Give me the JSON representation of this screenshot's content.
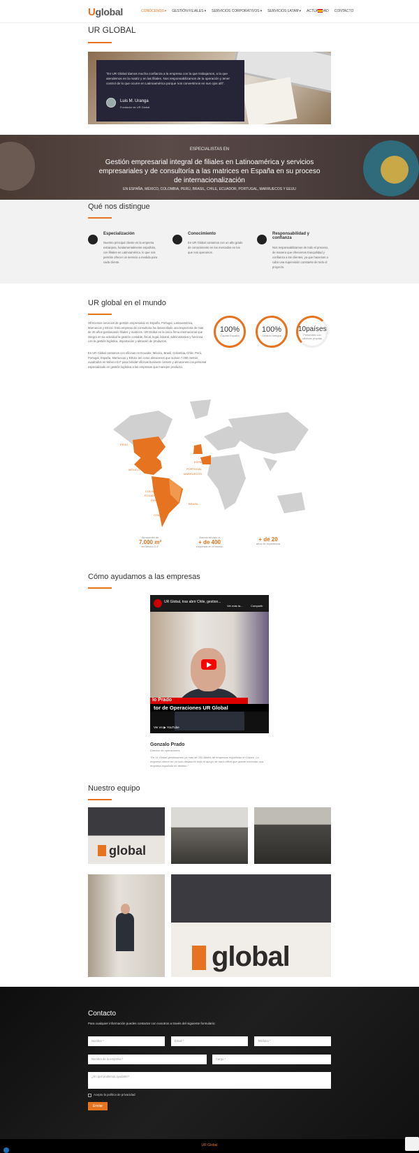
{
  "header": {
    "logo_u": "U",
    "logo_text": "global",
    "nav": [
      "CONÓCENOS",
      "GESTIÓN FILIALES",
      "SERVICIOS CORPORATIVOS",
      "SERVICIOS LATAM",
      "ACTUALIDAD",
      "CONTACTO"
    ]
  },
  "title": "UR GLOBAL",
  "quote": {
    "text": "“En UR Global damos mucha confianza a la empresa con la que trabajamos, a la que atendemos en la matriz y en las filiales. Nos responsabilizamos de la operación y tener control de lo que ocurre en Latinoamérica porque nos convertimos en sus ojos allí”.",
    "name": "Luis M. Uranga",
    "role": "Fundador de UR Global"
  },
  "band": {
    "subtitle": "ESPECIALISTAS EN",
    "title": "Gestión empresarial integral de filiales en Latinoamérica y servicios empresariales y de consultoría a las matrices en España en su proceso de internacionalización",
    "countries": "EN ESPAÑA, MÉXICO, COLOMBIA, PERÚ, BRASIL, CHILE, ECUADOR, PORTUGAL, MARRUECOS Y EEUU"
  },
  "distinguish": {
    "title": "Qué nos distingue",
    "items": [
      {
        "title": "Especialización",
        "text": "Nuestro principal cliente es la empresa extranjera, fundamentalmente española, con filiales en Latinoamérica, lo que nos permite ofrecer un servicio a medida para cada cliente."
      },
      {
        "title": "Conocimiento",
        "text": "En UR Global contamos con un alto grado de conocimiento en los mercados en los que nos operamos."
      },
      {
        "title": "Responsabilidad y confianza",
        "text": "Nos responsabilizamos de todo el proceso, de manera que ofrecemos tranquilidad y confianza a los clientes, ya que hacemos a cabo una supervisión constante de todo el proyecto."
      }
    ]
  },
  "world": {
    "title": "UR global en el mundo",
    "p1": "Ofrecemos servicios de gestión empresarial en España, Portugal, Latinoamérica, Marruecos y EEUU. Esta empresa de consultoría ha desarrollado una trayectoria de más de 20 años gestionando filiales y matrices. UR Global es la única firma internacional que integra en su actividad la gestión contable, fiscal, legal, laboral, administrativa y funciona con la gestión logística, importación y almacén de productos.",
    "p2": "En UR Global contamos con oficinas en Ecuador, México, Brasil, Colombia, Chile, Perú, Portugal, España, Marruecos y EEUU así como almacenes que suman 7.000 metros cuadrados en México D.F para brindar oficinas business centers y almacenes con personal especializado en gestión logística a las empresas que manejen producto.",
    "circles": [
      {
        "big": "100%",
        "small": "Capital España"
      },
      {
        "big": "100%",
        "small": "Gestión integral"
      },
      {
        "big": "10países",
        "small": "Presentes con oficinas propias"
      }
    ],
    "map_labels": [
      "EEUU",
      "MÉXICO",
      "COLOMBIA",
      "ECUADOR",
      "PERÚ",
      "CHILE",
      "BRASIL",
      "ESPAÑA",
      "PORTUGAL",
      "MARRUECOS"
    ],
    "stats": [
      {
        "pre": "Almacenes de",
        "big": "7.000 m²",
        "post": "en México D.F"
      },
      {
        "pre": "Damos servicio a",
        "big": "+ de 400",
        "post": "empresas en el mundo"
      },
      {
        "pre": "",
        "big": "+ de 20",
        "post": "años de experiencia"
      }
    ]
  },
  "help": {
    "title": "Cómo ayudamos a las empresas",
    "video_title": "UR Global, tras abrir Chile, gestion...",
    "video_later": "Ver más ta...",
    "video_share": "Compartir",
    "video_name": "lo Prado",
    "video_role": "tor de Operaciones UR Global",
    "video_watch": "Ver en ▶ YouTube",
    "person": "Gonzalo Prado",
    "person_role": "Director de operaciones",
    "person_quote": "“En Ur Global gestionamos ya más de 200 filiales de empresas españolas en Latam. La empresa ofrece en un solo despacho todo el apoyo de back-office que puede necesitar una empresa española en destino.”"
  },
  "team": {
    "title": "Nuestro equipo",
    "logo_text": "global"
  },
  "contact": {
    "title": "Contacto",
    "intro": "Para cualquier información puedes contactar con nosotros a través del siguiente formulario:",
    "name": "Nombre *",
    "email": "Email *",
    "phone": "Teléfono *",
    "company": "Nombre de la empresa *",
    "position": "Cargo *",
    "message": "¿En qué podemos ayudarte?",
    "privacy": "Acepto la política de privacidad",
    "send": "Enviar"
  },
  "footer": {
    "brand": "UR Global"
  },
  "colors": {
    "accent": "#e67320",
    "dark": "#262538"
  }
}
